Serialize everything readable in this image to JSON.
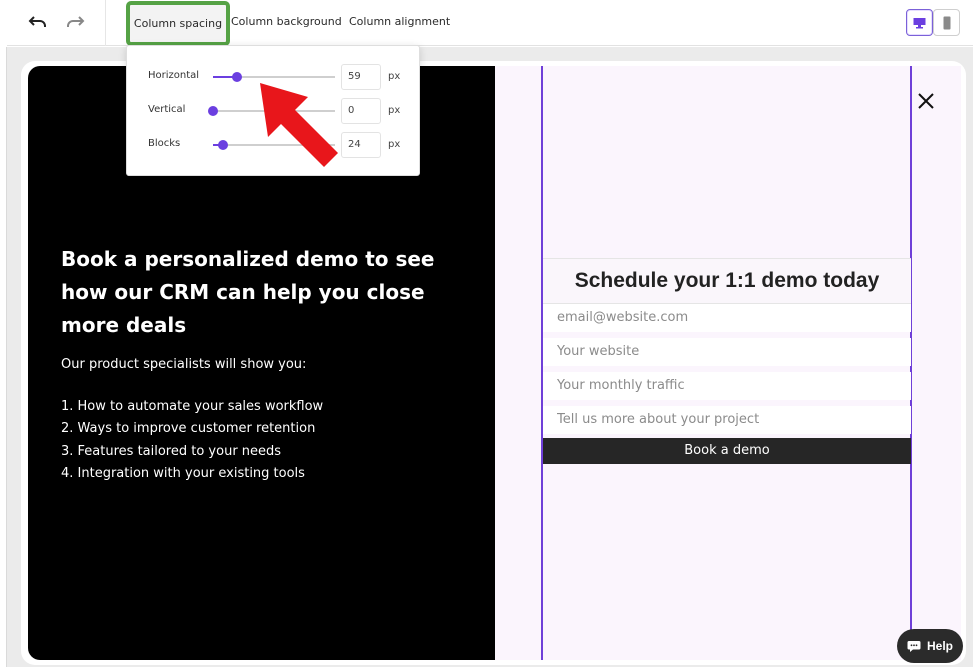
{
  "toolbar": {
    "undo_icon": "undo-icon",
    "redo_icon": "redo-icon",
    "tabs": [
      "Column spacing",
      "Column background",
      "Column alignment"
    ],
    "active_tab": "Column spacing",
    "desktop_icon": "desktop-icon",
    "mobile_icon": "mobile-icon"
  },
  "spacing_popover": {
    "rows": [
      {
        "label": "Horizontal",
        "value": "59",
        "unit": "px",
        "level": 0.2
      },
      {
        "label": "Vertical",
        "value": "0",
        "unit": "px",
        "level": 0.0
      },
      {
        "label": "Blocks",
        "value": "24",
        "unit": "px",
        "level": 0.08
      }
    ]
  },
  "hero": {
    "headline": "Book a personalized demo to see how our CRM can help you close more deals",
    "intro": "Our product specialists will show you:",
    "steps": [
      "1. How to automate your sales workflow",
      "2. Ways to improve customer retention",
      "3. Features tailored to your needs",
      "4. Integration with your existing tools"
    ]
  },
  "form": {
    "title": "Schedule your 1:1 demo today",
    "email_placeholder": "email@website.com",
    "website_placeholder": "Your website",
    "traffic_placeholder": "Your monthly traffic",
    "project_placeholder": "Tell us more about your project",
    "submit_label": "Book a demo"
  },
  "help": {
    "label": "Help",
    "icon": "chat-icon"
  },
  "colors": {
    "accent": "#6b3fe0",
    "highlight_box": "#55a245",
    "annotation_arrow": "#e8161b",
    "hero_background": "#000000",
    "form_panel_background": "#fbf5fd"
  }
}
